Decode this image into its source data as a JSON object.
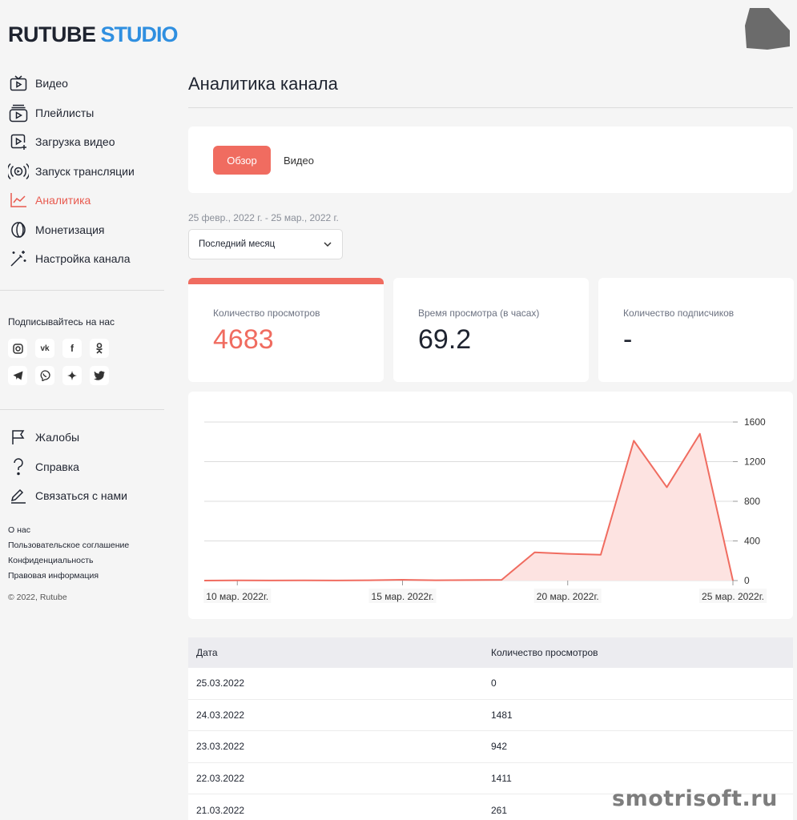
{
  "brand": {
    "part1": "RUTUBE",
    "part2": "STUDIO"
  },
  "nav": [
    {
      "label": "Видео",
      "icon": "tv-icon"
    },
    {
      "label": "Плейлисты",
      "icon": "playlist-icon"
    },
    {
      "label": "Загрузка видео",
      "icon": "upload-video-icon"
    },
    {
      "label": "Запуск трансляции",
      "icon": "broadcast-icon"
    },
    {
      "label": "Аналитика",
      "icon": "analytics-icon",
      "active": true
    },
    {
      "label": "Монетизация",
      "icon": "coin-icon"
    },
    {
      "label": "Настройка канала",
      "icon": "magic-wand-icon"
    }
  ],
  "social": {
    "title": "Подписывайтесь на нас",
    "icons": [
      "instagram-icon",
      "vk-icon",
      "facebook-icon",
      "odnoklassniki-icon",
      "telegram-icon",
      "viber-icon",
      "zen-icon",
      "twitter-icon"
    ]
  },
  "nav2": [
    {
      "label": "Жалобы",
      "icon": "flag-icon"
    },
    {
      "label": "Справка",
      "icon": "question-icon"
    },
    {
      "label": "Связаться с нами",
      "icon": "edit-icon"
    }
  ],
  "footer": {
    "links": [
      "О нас",
      "Пользовательское соглашение",
      "Конфиденциальность",
      "Правовая информация"
    ],
    "copyright": "© 2022, Rutube"
  },
  "page": {
    "title": "Аналитика канала"
  },
  "tabs": {
    "overview": "Обзор",
    "video": "Видео"
  },
  "range": "25 февр., 2022 г. - 25 мар., 2022 г.",
  "period_select": "Последний месяц",
  "stats": {
    "views": {
      "label": "Количество просмотров",
      "value": "4683"
    },
    "watch_time": {
      "label": "Время просмотра (в часах)",
      "value": "69.2"
    },
    "subscribers": {
      "label": "Количество подписчиков",
      "value": "-"
    }
  },
  "chart_data": {
    "type": "area",
    "x": [
      "09.03.2022",
      "10.03.2022",
      "11.03.2022",
      "12.03.2022",
      "13.03.2022",
      "14.03.2022",
      "15.03.2022",
      "16.03.2022",
      "17.03.2022",
      "18.03.2022",
      "19.03.2022",
      "20.03.2022",
      "21.03.2022",
      "22.03.2022",
      "23.03.2022",
      "24.03.2022",
      "25.03.2022"
    ],
    "values": [
      0,
      2,
      1,
      2,
      1,
      3,
      8,
      3,
      5,
      7,
      285,
      270,
      261,
      1411,
      942,
      1481,
      0
    ],
    "ylim": [
      0,
      1600
    ],
    "yticks": [
      "0",
      "400",
      "800",
      "1200",
      "1600"
    ],
    "xticks": [
      {
        "at": "10.03.2022",
        "label": "10 мар. 2022г."
      },
      {
        "at": "15.03.2022",
        "label": "15 мар. 2022г."
      },
      {
        "at": "20.03.2022",
        "label": "20 мар. 2022г."
      },
      {
        "at": "25.03.2022",
        "label": "25 мар. 2022г."
      }
    ],
    "grid": true,
    "line_color": "#f06c60",
    "fill_color": "#fde3e1"
  },
  "table": {
    "headers": [
      "Дата",
      "Количество просмотров"
    ],
    "rows": [
      [
        "25.03.2022",
        "0"
      ],
      [
        "24.03.2022",
        "1481"
      ],
      [
        "23.03.2022",
        "942"
      ],
      [
        "22.03.2022",
        "1411"
      ],
      [
        "21.03.2022",
        "261"
      ]
    ]
  },
  "watermark": "smotrisoft.ru"
}
